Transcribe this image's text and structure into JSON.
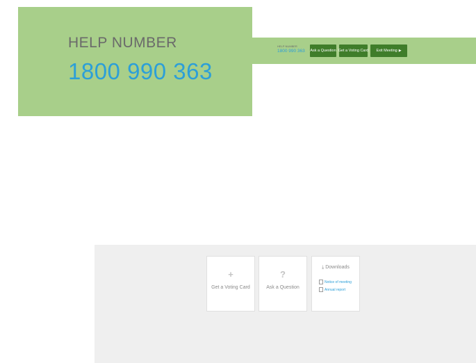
{
  "help_zoom": {
    "label": "HELP NUMBER",
    "number": "1800 990 363"
  },
  "topbar": {
    "help_label": "HELP NUMBER",
    "help_number": "1800 990 363",
    "buttons": [
      {
        "label": "Ask a Question"
      },
      {
        "label": "Get a Voting Card"
      },
      {
        "label": "Exit Meeting",
        "icon": "arrow-right-icon"
      }
    ]
  },
  "cards": {
    "voting": {
      "icon": "plus-icon",
      "glyph": "+",
      "label": "Get a Voting Card"
    },
    "question": {
      "icon": "question-icon",
      "glyph": "?",
      "label": "Ask a Question"
    },
    "downloads": {
      "icon": "download-icon",
      "glyph": "⤓",
      "title": "Downloads",
      "items": [
        {
          "label": "Notice of meeting"
        },
        {
          "label": "Annual report"
        }
      ]
    }
  },
  "colors": {
    "green_panel": "#a8cf8a",
    "button_green": "#3f7d2a",
    "link_blue": "#2c9fd8",
    "panel_grey": "#efefef"
  }
}
